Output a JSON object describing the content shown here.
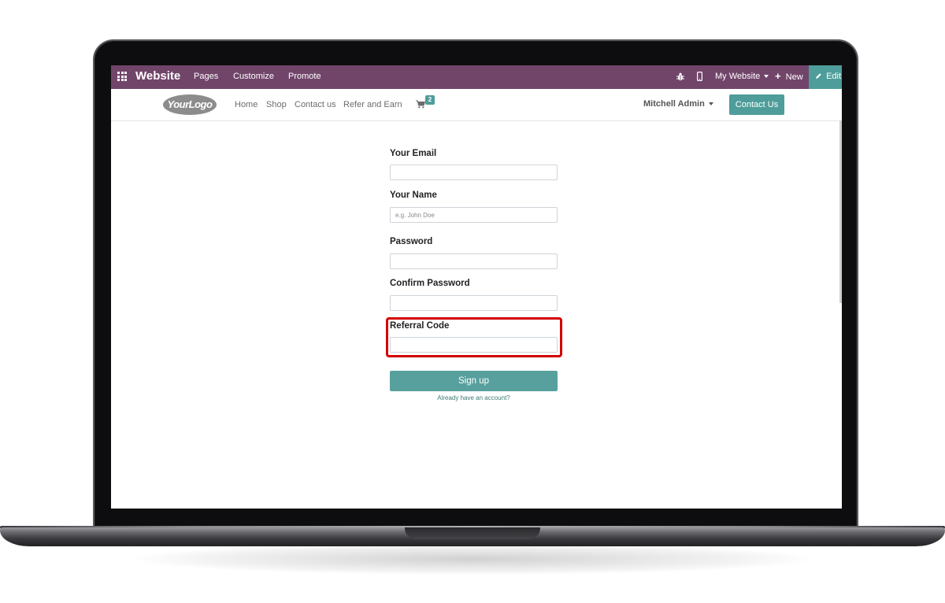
{
  "topbar": {
    "title": "Website",
    "menu": [
      "Pages",
      "Customize",
      "Promote"
    ],
    "website_label": "My Website",
    "new_label": "New",
    "edit_label": "Edit",
    "bg_color": "#71456a",
    "edit_bg_color": "#4e9d9a"
  },
  "navbar": {
    "logo_text": "YourLogo",
    "links": [
      "Home",
      "Shop",
      "Contact us",
      "Refer and Earn"
    ],
    "cart_count": "2",
    "user_name": "Mitchell Admin",
    "contact_button": "Contact Us"
  },
  "form": {
    "email_label": "Your Email",
    "email_value": "",
    "name_label": "Your Name",
    "name_placeholder": "e.g. John Doe",
    "password_label": "Password",
    "confirm_label": "Confirm Password",
    "referral_label": "Referral Code",
    "referral_value": "",
    "signup_button": "Sign up",
    "login_link": "Already have an account?",
    "highlight_color": "#d40000",
    "button_color": "#58a09d"
  }
}
